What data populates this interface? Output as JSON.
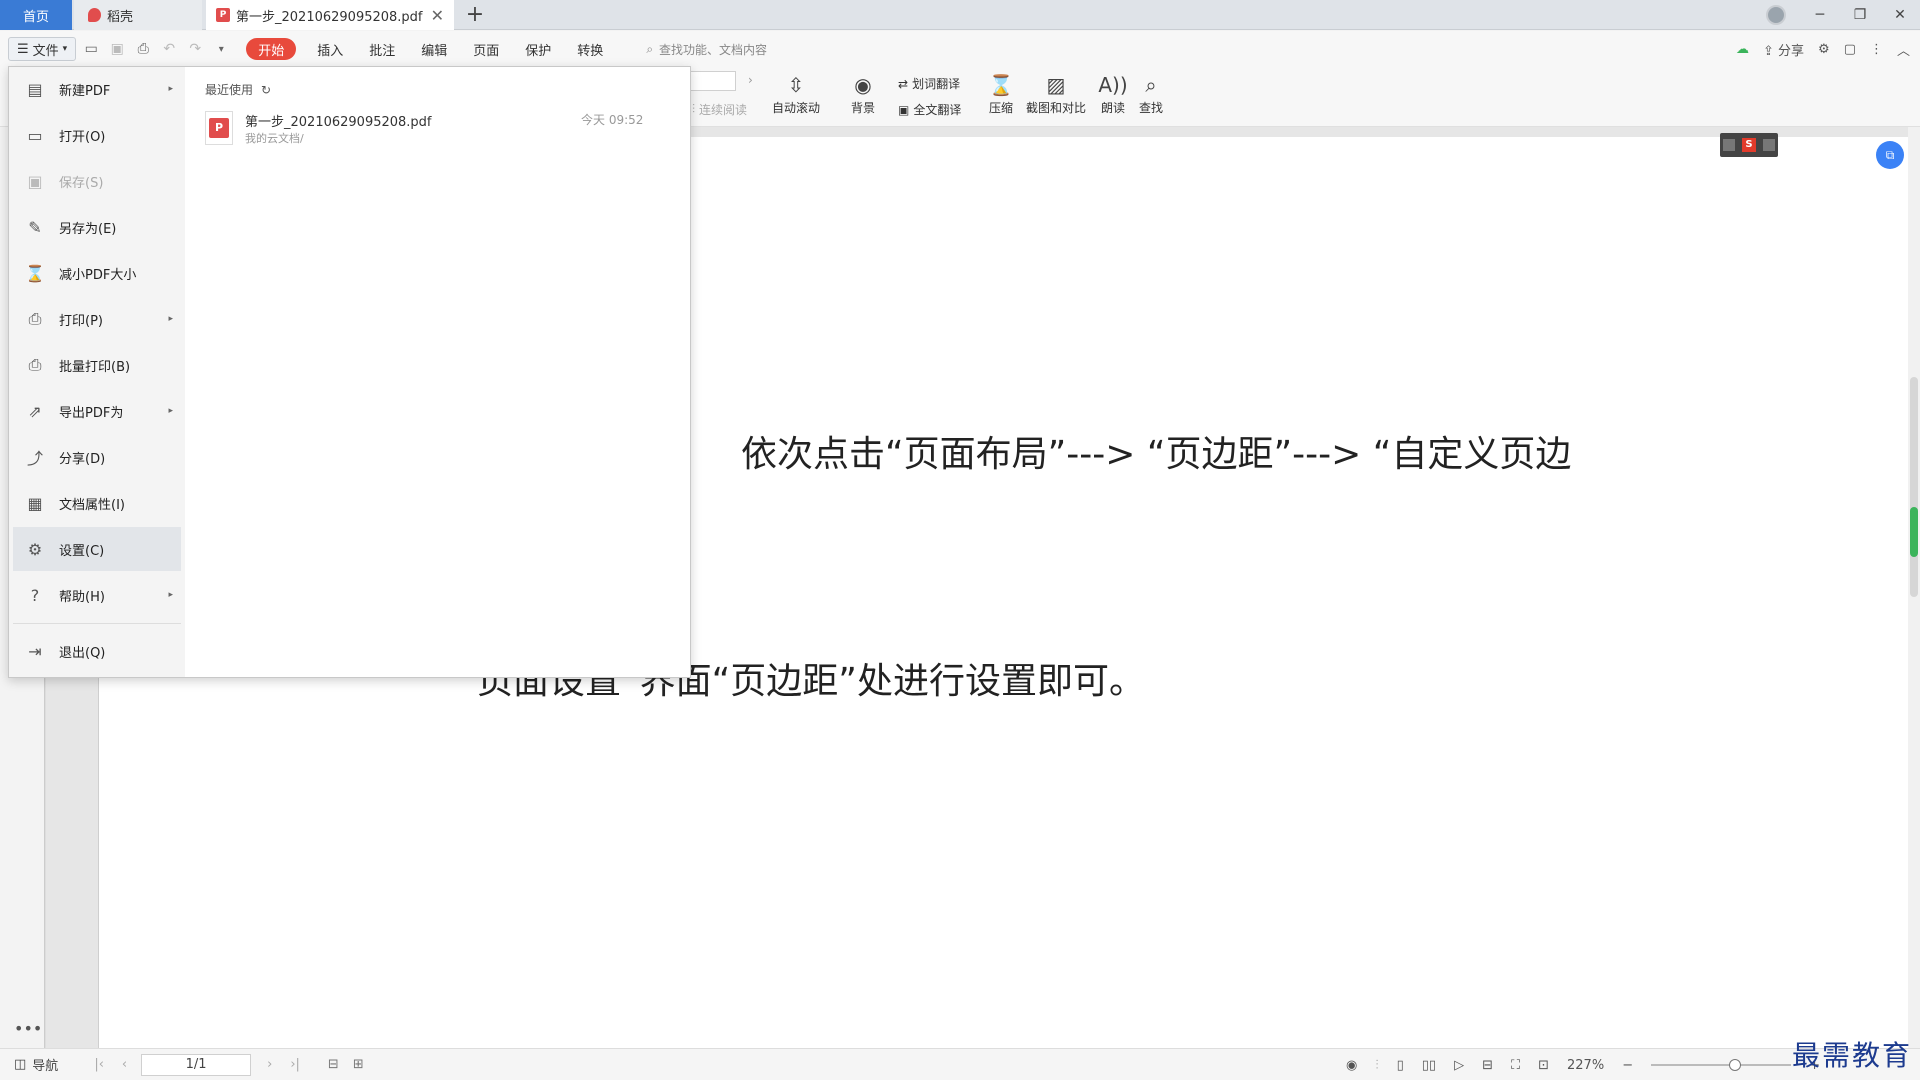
{
  "tabs": {
    "home": "首页",
    "daoke": "稻壳",
    "doc": "第一步_20210629095208.pdf",
    "add": "+",
    "close": "✕"
  },
  "menubar": {
    "file": "文件",
    "tabs": [
      "开始",
      "插入",
      "批注",
      "编辑",
      "页面",
      "保护",
      "转换"
    ],
    "search_placeholder": "查找功能、文档内容",
    "share": "分享"
  },
  "ribbon": {
    "continuous_read": "连续阅读",
    "auto_scroll": "自动滚动",
    "background": "背景",
    "word_translate": "划词翻译",
    "full_translate": "全文翻译",
    "compress": "压缩",
    "screenshot_compare": "截图和对比",
    "read_aloud": "朗读",
    "find": "查找"
  },
  "filemenu": {
    "items": [
      {
        "label": "新建PDF",
        "icon": "new-pdf-icon"
      },
      {
        "label": "打开(O)",
        "icon": "folder-open-icon"
      },
      {
        "label": "保存(S)",
        "icon": "save-icon"
      },
      {
        "label": "另存为(E)",
        "icon": "save-as-icon"
      },
      {
        "label": "减小PDF大小",
        "icon": "compress-icon"
      },
      {
        "label": "打印(P)",
        "icon": "print-icon"
      },
      {
        "label": "批量打印(B)",
        "icon": "batch-print-icon"
      },
      {
        "label": "导出PDF为",
        "icon": "export-icon"
      },
      {
        "label": "分享(D)",
        "icon": "share-icon"
      },
      {
        "label": "文档属性(I)",
        "icon": "properties-icon"
      },
      {
        "label": "设置(C)",
        "icon": "gear-icon"
      },
      {
        "label": "帮助(H)",
        "icon": "help-icon"
      },
      {
        "label": "退出(Q)",
        "icon": "exit-icon"
      }
    ],
    "recent_title": "最近使用",
    "recent": [
      {
        "name": "第一步_20210629095208.pdf",
        "location": "我的云文档/",
        "time": "今天 09:52"
      }
    ]
  },
  "document": {
    "line1": "依次点击“页面布局”---> “页边距”---> “自定义页边",
    "line2": "页面设置”界面“页边距”处进行设置即可。"
  },
  "statusbar": {
    "nav": "导航",
    "page": "1/1",
    "zoom": "227%"
  },
  "watermark": "最需教育",
  "colors": {
    "accent": "#3a7bd5",
    "active_tab": "#e84a3c",
    "pdf_red": "#e14d4d"
  }
}
